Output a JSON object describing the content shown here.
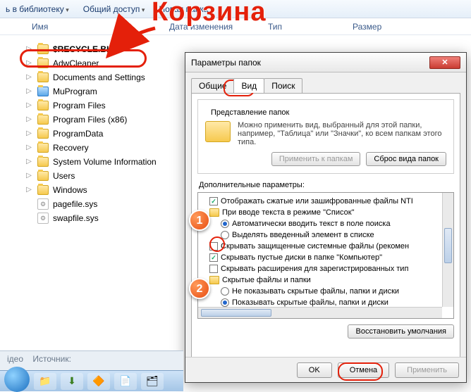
{
  "annotation": {
    "title": "Корзина"
  },
  "toolbar": {
    "library": "ь в библиотеку",
    "share": "Общий доступ",
    "newfolder": "Новая папка"
  },
  "columns": {
    "name": "Имя",
    "date": "Дата изменения",
    "type": "Тип",
    "size": "Размер"
  },
  "files": [
    {
      "icon": "folder",
      "label": "$RECYCLE.BIN"
    },
    {
      "icon": "folder",
      "label": "AdwCleaner"
    },
    {
      "icon": "folder",
      "label": "Documents and Settings"
    },
    {
      "icon": "folder-blue",
      "label": "MuProgram"
    },
    {
      "icon": "folder",
      "label": "Program Files"
    },
    {
      "icon": "folder",
      "label": "Program Files (x86)"
    },
    {
      "icon": "folder",
      "label": "ProgramData"
    },
    {
      "icon": "folder",
      "label": "Recovery"
    },
    {
      "icon": "folder",
      "label": "System Volume Information"
    },
    {
      "icon": "folder",
      "label": "Users"
    },
    {
      "icon": "folder",
      "label": "Windows"
    },
    {
      "icon": "sys",
      "label": "pagefile.sys"
    },
    {
      "icon": "sys",
      "label": "swapfile.sys"
    }
  ],
  "dialog": {
    "title": "Параметры папок",
    "tabs": [
      "Общие",
      "Вид",
      "Поиск"
    ],
    "group_title": "Представление папок",
    "group_text": "Можно применить вид, выбранный для этой папки, например, \"Таблица\" или \"Значки\", ко всем папкам этого типа.",
    "apply_folders": "Применить к папкам",
    "reset_folders": "Сброс вида папок",
    "adv_title": "Дополнительные параметры:",
    "tree": [
      {
        "kind": "cb",
        "checked": true,
        "ind": 1,
        "label": "Отображать сжатые или зашифрованные файлы NTI"
      },
      {
        "kind": "folder",
        "ind": 1,
        "label": "При вводе текста в режиме \"Список\""
      },
      {
        "kind": "rb",
        "checked": true,
        "ind": 2,
        "label": "Автоматически вводить текст в поле поиска"
      },
      {
        "kind": "rb",
        "checked": false,
        "ind": 2,
        "label": "Выделять введенный элемент в списке"
      },
      {
        "kind": "cb",
        "checked": false,
        "ind": 1,
        "label": "Скрывать защищенные системные файлы (рекомен"
      },
      {
        "kind": "cb",
        "checked": true,
        "ind": 1,
        "label": "Скрывать пустые диски в папке \"Компьютер\""
      },
      {
        "kind": "cb",
        "checked": false,
        "ind": 1,
        "label": "Скрывать расширения для зарегистрированных тип"
      },
      {
        "kind": "folder",
        "ind": 1,
        "label": "Скрытые файлы и папки"
      },
      {
        "kind": "rb",
        "checked": false,
        "ind": 2,
        "label": "Не показывать скрытые файлы, папки и диски"
      },
      {
        "kind": "rb",
        "checked": true,
        "ind": 2,
        "label": "Показывать скрытые файлы, папки и диски"
      }
    ],
    "restore": "Восстановить умолчания",
    "ok": "OK",
    "cancel": "Отмена",
    "apply": "Применить"
  },
  "bottombar": {
    "t1": "ідео",
    "t2": "Источник:"
  },
  "markers": {
    "one": "1",
    "two": "2"
  }
}
